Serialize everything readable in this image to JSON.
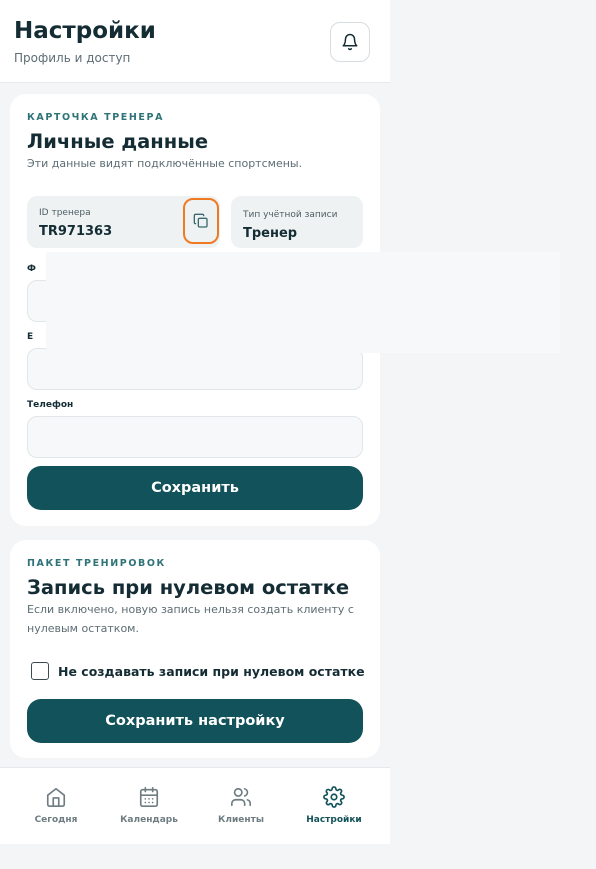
{
  "header": {
    "title": "Настройки",
    "subtitle": "Профиль и доступ",
    "notifications_icon": "bell-icon"
  },
  "profile_card": {
    "eyebrow": "КАРТОЧКА ТРЕНЕРА",
    "title": "Личные данные",
    "description": "Эти данные видят подключённые спортсмены.",
    "trainer_id": {
      "label": "ID тренера",
      "value": "TR971363",
      "copy_icon": "copy-icon"
    },
    "account_type": {
      "label": "Тип учётной записи",
      "value": "Тренер"
    },
    "fields": [
      {
        "label": "Ф",
        "value": ""
      },
      {
        "label": "E",
        "value": ""
      },
      {
        "label": "Телефон",
        "value": ""
      }
    ],
    "save_label": "Сохранить"
  },
  "package_card": {
    "eyebrow": "ПАКЕТ ТРЕНИРОВОК",
    "title": "Запись при нулевом остатке",
    "description": "Если включено, новую запись нельзя создать клиенту с нулевым остатком.",
    "checkbox_label": "Не создавать записи при нулевом остатке",
    "checkbox_checked": false,
    "save_label": "Сохранить настройку"
  },
  "nav": {
    "items": [
      {
        "label": "Сегодня",
        "icon": "home-icon",
        "active": false
      },
      {
        "label": "Календарь",
        "icon": "calendar-icon",
        "active": false
      },
      {
        "label": "Клиенты",
        "icon": "users-icon",
        "active": false
      },
      {
        "label": "Настройки",
        "icon": "gear-icon",
        "active": true
      }
    ]
  },
  "colors": {
    "primary": "#12525a",
    "accent": "#2e7378",
    "highlight": "#f07a22",
    "text": "#142c34",
    "muted": "#5d6d73"
  }
}
